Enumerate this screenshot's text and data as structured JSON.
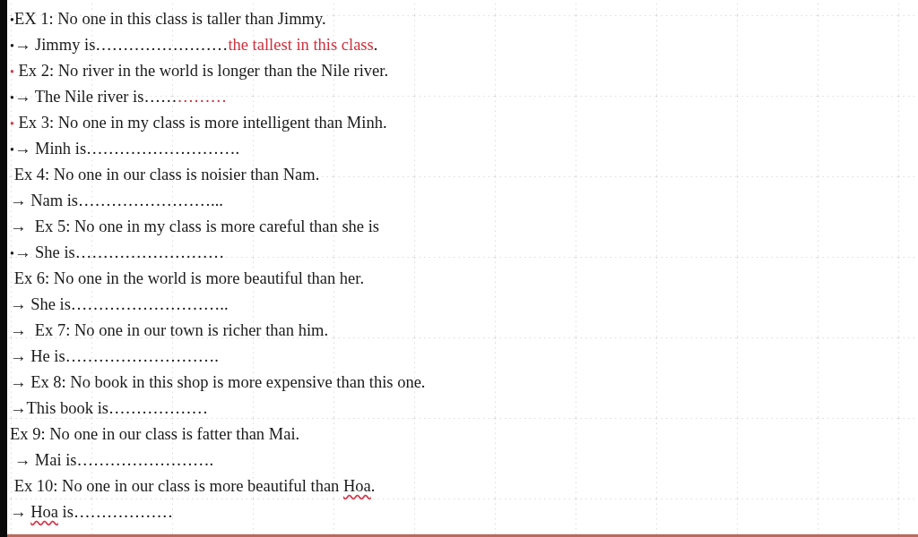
{
  "lines": [
    {
      "parts": [
        {
          "kind": "bullet",
          "text": "•"
        },
        {
          "kind": "plain",
          "text": "EX 1: No one in this class is taller than Jimmy."
        }
      ]
    },
    {
      "parts": [
        {
          "kind": "bullet",
          "text": "•"
        },
        {
          "kind": "plain",
          "text": "→ Jimmy is……………………"
        },
        {
          "kind": "answer",
          "text": "the tallest in this class"
        },
        {
          "kind": "plain",
          "text": "."
        }
      ]
    },
    {
      "parts": [
        {
          "kind": "red-bullet",
          "text": "•"
        },
        {
          "kind": "plain",
          "text": " Ex 2: No river in the world is longer than the Nile river."
        }
      ]
    },
    {
      "parts": [
        {
          "kind": "bullet",
          "text": "•"
        },
        {
          "kind": "plain",
          "text": "→ The Nile river is……"
        },
        {
          "kind": "answer",
          "text": "………"
        }
      ]
    },
    {
      "parts": [
        {
          "kind": "red-bullet",
          "text": "•"
        },
        {
          "kind": "plain",
          "text": " Ex 3: No one in my class is more intelligent than Minh."
        }
      ]
    },
    {
      "parts": [
        {
          "kind": "bullet",
          "text": "•"
        },
        {
          "kind": "plain",
          "text": "→ Minh is………………………."
        }
      ]
    },
    {
      "parts": [
        {
          "kind": "plain",
          "text": " Ex 4: No one in our class is noisier than Nam."
        }
      ]
    },
    {
      "parts": [
        {
          "kind": "plain",
          "text": "→ Nam is……………………..."
        }
      ]
    },
    {
      "parts": [
        {
          "kind": "plain",
          "text": "→  Ex 5: No one in my class is more careful than she is"
        }
      ]
    },
    {
      "parts": [
        {
          "kind": "bullet",
          "text": "•"
        },
        {
          "kind": "plain",
          "text": "→ She is………………………"
        }
      ]
    },
    {
      "parts": [
        {
          "kind": "plain",
          "text": " Ex 6: No one in the world is more beautiful than her."
        }
      ]
    },
    {
      "parts": [
        {
          "kind": "plain",
          "text": "→ She is……………………….."
        }
      ]
    },
    {
      "parts": [
        {
          "kind": "plain",
          "text": "→  Ex 7: No one in our town is richer than him."
        }
      ]
    },
    {
      "parts": [
        {
          "kind": "plain",
          "text": "→ He is………………………."
        }
      ]
    },
    {
      "parts": [
        {
          "kind": "plain",
          "text": "→ Ex 8: No book in this shop is more expensive than this one."
        }
      ]
    },
    {
      "parts": [
        {
          "kind": "plain",
          "text": "→This book is………………"
        }
      ]
    },
    {
      "parts": [
        {
          "kind": "plain",
          "text": "Ex 9: No one in our class is fatter than Mai."
        }
      ]
    },
    {
      "parts": [
        {
          "kind": "plain",
          "text": " → Mai is……………………."
        }
      ]
    },
    {
      "parts": [
        {
          "kind": "plain",
          "text": " Ex 10: No one in our class is more beautiful than "
        },
        {
          "kind": "flagged",
          "text": "Hoa"
        },
        {
          "kind": "plain",
          "text": "."
        }
      ]
    },
    {
      "parts": [
        {
          "kind": "plain",
          "text": "→ "
        },
        {
          "kind": "flagged",
          "text": "Hoa"
        },
        {
          "kind": "plain",
          "text": " is………………"
        }
      ]
    }
  ]
}
